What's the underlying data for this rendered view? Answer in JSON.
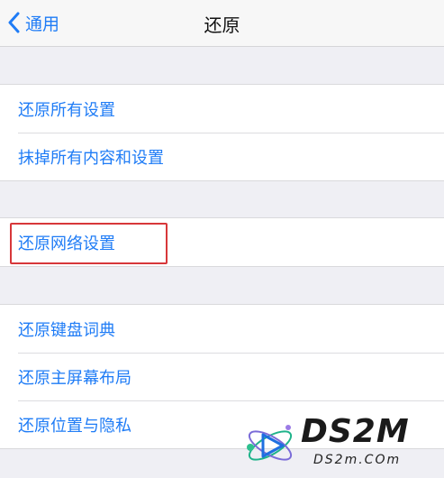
{
  "navbar": {
    "back_label": "通用",
    "title": "还原"
  },
  "groups": [
    {
      "items": [
        "还原所有设置",
        "抹掉所有内容和设置"
      ]
    },
    {
      "items": [
        "还原网络设置"
      ]
    },
    {
      "items": [
        "还原键盘词典",
        "还原主屏幕布局",
        "还原位置与隐私"
      ]
    }
  ],
  "colors": {
    "accent": "#1f7cf6",
    "highlight": "#d7373a",
    "background": "#efeff4"
  },
  "icons": [
    "chevron-left-icon"
  ],
  "watermark": {
    "brand": "DS2M",
    "domain": "DS2m.COm"
  }
}
